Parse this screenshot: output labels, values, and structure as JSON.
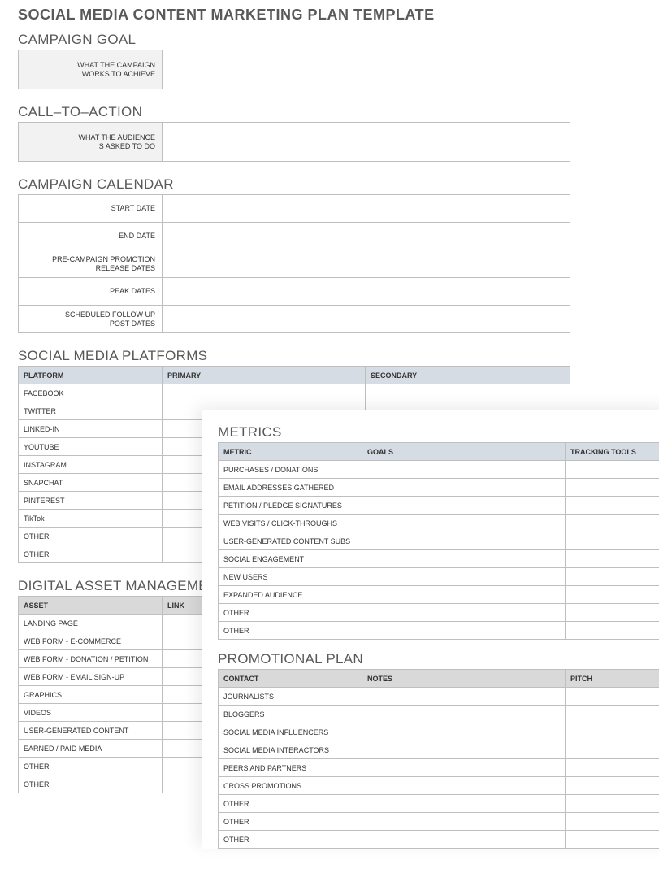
{
  "doc_title": "SOCIAL MEDIA CONTENT MARKETING PLAN TEMPLATE",
  "goal": {
    "title": "CAMPAIGN GOAL",
    "label_l1": "WHAT THE CAMPAIGN",
    "label_l2": "WORKS TO ACHIEVE",
    "value": ""
  },
  "cta": {
    "title": "CALL–TO–ACTION",
    "label_l1": "WHAT THE AUDIENCE",
    "label_l2": "IS ASKED TO DO",
    "value": ""
  },
  "calendar": {
    "title": "CAMPAIGN CALENDAR",
    "rows": [
      {
        "l1": "START DATE",
        "l2": "",
        "value": ""
      },
      {
        "l1": "END DATE",
        "l2": "",
        "value": ""
      },
      {
        "l1": "PRE-CAMPAIGN PROMOTION",
        "l2": "RELEASE DATES",
        "value": ""
      },
      {
        "l1": "PEAK DATES",
        "l2": "",
        "value": ""
      },
      {
        "l1": "SCHEDULED FOLLOW UP",
        "l2": "POST DATES",
        "value": ""
      }
    ]
  },
  "platforms": {
    "title": "SOCIAL MEDIA PLATFORMS",
    "headers": {
      "c1": "PLATFORM",
      "c2": "PRIMARY",
      "c3": "SECONDARY"
    },
    "rows": [
      {
        "c1": "FACEBOOK",
        "c2": "",
        "c3": ""
      },
      {
        "c1": "TWITTER",
        "c2": "",
        "c3": ""
      },
      {
        "c1": "LINKED-IN",
        "c2": "",
        "c3": ""
      },
      {
        "c1": "YOUTUBE",
        "c2": "",
        "c3": ""
      },
      {
        "c1": "INSTAGRAM",
        "c2": "",
        "c3": ""
      },
      {
        "c1": "SNAPCHAT",
        "c2": "",
        "c3": ""
      },
      {
        "c1": "PINTEREST",
        "c2": "",
        "c3": ""
      },
      {
        "c1": "TikTok",
        "c2": "",
        "c3": ""
      },
      {
        "c1": "OTHER",
        "c2": "",
        "c3": ""
      },
      {
        "c1": "OTHER",
        "c2": "",
        "c3": ""
      }
    ]
  },
  "assets": {
    "title": "DIGITAL ASSET MANAGEMENT",
    "headers": {
      "c1": "ASSET",
      "c2": "LINK"
    },
    "rows": [
      {
        "c1": "LANDING PAGE",
        "c2": ""
      },
      {
        "c1": "WEB FORM - E-COMMERCE",
        "c2": ""
      },
      {
        "c1": "WEB FORM - DONATION / PETITION",
        "c2": ""
      },
      {
        "c1": "WEB FORM - EMAIL SIGN-UP",
        "c2": ""
      },
      {
        "c1": "GRAPHICS",
        "c2": ""
      },
      {
        "c1": "VIDEOS",
        "c2": ""
      },
      {
        "c1": "USER-GENERATED CONTENT",
        "c2": ""
      },
      {
        "c1": "EARNED / PAID MEDIA",
        "c2": ""
      },
      {
        "c1": "OTHER",
        "c2": ""
      },
      {
        "c1": "OTHER",
        "c2": ""
      }
    ]
  },
  "metrics": {
    "title": "METRICS",
    "headers": {
      "c1": "METRIC",
      "c2": "GOALS",
      "c3": "TRACKING TOOLS"
    },
    "rows": [
      {
        "c1": "PURCHASES / DONATIONS",
        "c2": "",
        "c3": ""
      },
      {
        "c1": "EMAIL ADDRESSES GATHERED",
        "c2": "",
        "c3": ""
      },
      {
        "c1": "PETITION / PLEDGE SIGNATURES",
        "c2": "",
        "c3": ""
      },
      {
        "c1": "WEB VISITS / CLICK-THROUGHS",
        "c2": "",
        "c3": ""
      },
      {
        "c1": "USER-GENERATED CONTENT SUBS",
        "c2": "",
        "c3": ""
      },
      {
        "c1": "SOCIAL ENGAGEMENT",
        "c2": "",
        "c3": ""
      },
      {
        "c1": "NEW USERS",
        "c2": "",
        "c3": ""
      },
      {
        "c1": "EXPANDED AUDIENCE",
        "c2": "",
        "c3": ""
      },
      {
        "c1": "OTHER",
        "c2": "",
        "c3": ""
      },
      {
        "c1": "OTHER",
        "c2": "",
        "c3": ""
      }
    ]
  },
  "promo": {
    "title": "PROMOTIONAL PLAN",
    "headers": {
      "c1": "CONTACT",
      "c2": "NOTES",
      "c3": "PITCH"
    },
    "rows": [
      {
        "c1": "JOURNALISTS",
        "c2": "",
        "c3": ""
      },
      {
        "c1": "BLOGGERS",
        "c2": "",
        "c3": ""
      },
      {
        "c1": "SOCIAL MEDIA INFLUENCERS",
        "c2": "",
        "c3": ""
      },
      {
        "c1": "SOCIAL MEDIA INTERACTORS",
        "c2": "",
        "c3": ""
      },
      {
        "c1": "PEERS AND PARTNERS",
        "c2": "",
        "c3": ""
      },
      {
        "c1": "CROSS PROMOTIONS",
        "c2": "",
        "c3": ""
      },
      {
        "c1": "OTHER",
        "c2": "",
        "c3": ""
      },
      {
        "c1": "OTHER",
        "c2": "",
        "c3": ""
      },
      {
        "c1": "OTHER",
        "c2": "",
        "c3": ""
      }
    ]
  }
}
